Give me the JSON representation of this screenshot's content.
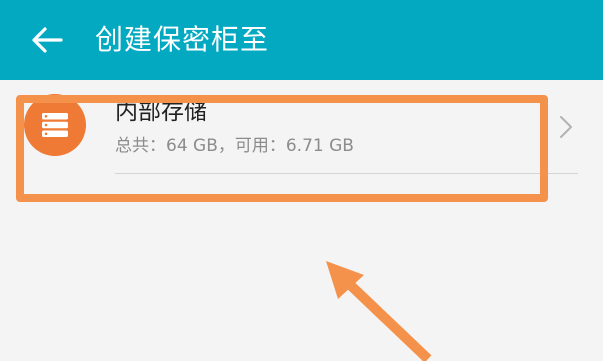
{
  "app_bar": {
    "title": "创建保密柜至",
    "background": "#03a9c1",
    "back_icon": "arrow-left-icon"
  },
  "storage": {
    "title": "内部存储",
    "detail": "总共：64 GB，可用：6.71 GB",
    "icon": "storage-stack-icon",
    "icon_color": "#ef7a35",
    "chevron_icon": "chevron-right-icon"
  },
  "annotation": {
    "highlight_color": "#f4924b",
    "arrow_icon": "pointer-arrow-icon"
  }
}
